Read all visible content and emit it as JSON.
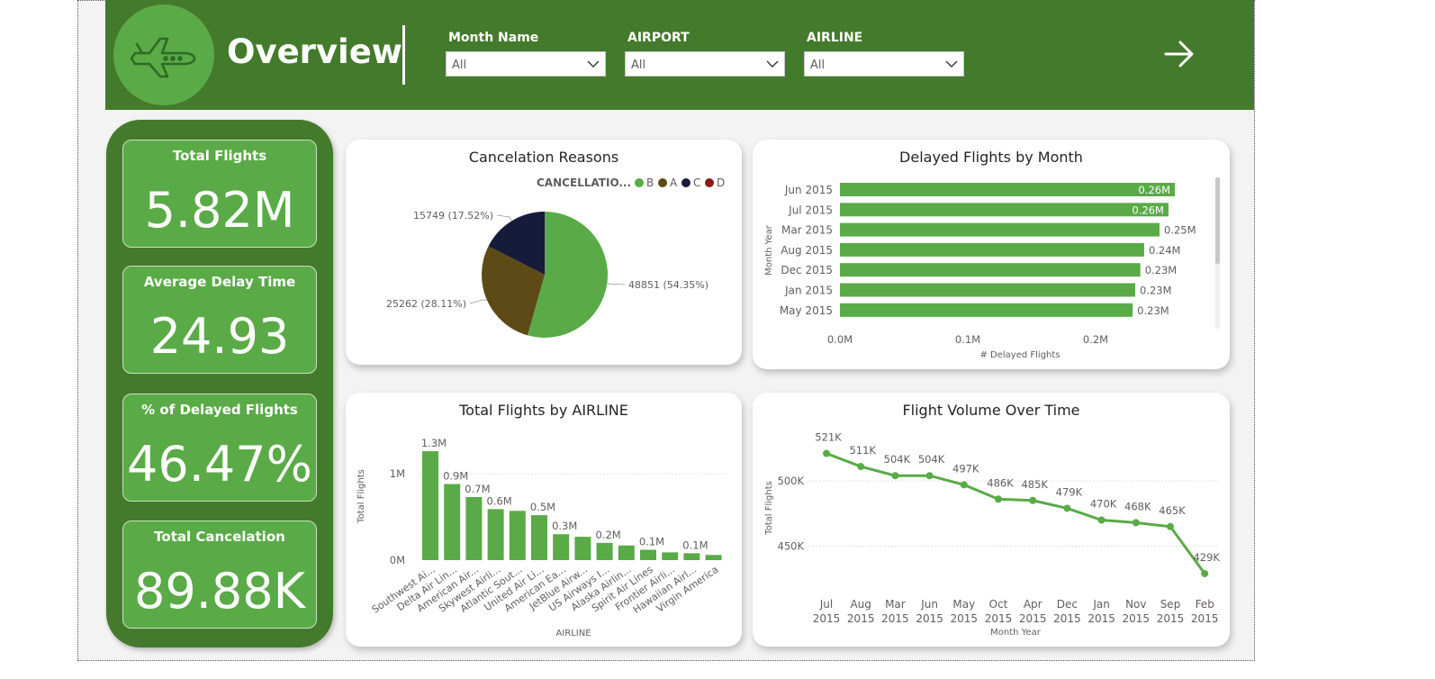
{
  "header": {
    "title": "Overview",
    "slicers": [
      {
        "label": "Month Name",
        "value": "All"
      },
      {
        "label": "AIRPORT",
        "value": "All"
      },
      {
        "label": "AIRLINE",
        "value": "All"
      }
    ],
    "icons": {
      "logo": "airplane-icon",
      "next": "arrow-right-icon",
      "dropdown": "chevron-down-icon"
    }
  },
  "kpis": [
    {
      "title": "Total Flights",
      "value": "5.82M"
    },
    {
      "title": "Average Delay Time",
      "value": "24.93"
    },
    {
      "title": "% of Delayed Flights",
      "value": "46.47%"
    },
    {
      "title": "Total Cancelation",
      "value": "89.88K"
    }
  ],
  "colors": {
    "header": "#447a2c",
    "accent": "#5aaa47",
    "pieB": "#5aaa47",
    "pieA": "#5e4a16",
    "pieC": "#161b3a",
    "pieD": "#8b1a1a"
  },
  "chart_data": [
    {
      "type": "pie",
      "title": "Cancelation Reasons",
      "legend_title": "CANCELLATIO...",
      "legend_position": "top-right",
      "categories": [
        "B",
        "A",
        "C",
        "D"
      ],
      "values": [
        48851,
        25262,
        15749,
        0
      ],
      "labels": [
        "48851 (54.35%)",
        "25262 (28.11%)",
        "15749 (17.52%)",
        ""
      ]
    },
    {
      "type": "bar",
      "orientation": "horizontal",
      "title": "Delayed Flights by Month",
      "xlabel": "# Delayed Flights",
      "ylabel": "Month Year",
      "categories": [
        "Jun 2015",
        "Jul 2015",
        "Mar 2015",
        "Aug 2015",
        "Dec 2015",
        "Jan 2015",
        "May 2015"
      ],
      "values": [
        0.262,
        0.257,
        0.25,
        0.238,
        0.235,
        0.231,
        0.229
      ],
      "data_labels": [
        "0.26M",
        "0.26M",
        "0.25M",
        "0.24M",
        "0.23M",
        "0.23M",
        "0.23M"
      ],
      "xlim": [
        0,
        0.3
      ],
      "xticks": [
        "0.0M",
        "0.1M",
        "0.2M"
      ]
    },
    {
      "type": "bar",
      "title": "Total Flights by AIRLINE",
      "xlabel": "AIRLINE",
      "ylabel": "Total Flights",
      "categories": [
        "Southwest Ai...",
        "Delta Air Lin...",
        "American Air...",
        "Skywest Airli...",
        "Atlantic Sout...",
        "United Air Li...",
        "American Ea...",
        "JetBlue Airw...",
        "US Airways I...",
        "Alaska Airlin...",
        "Spirit Air Lines",
        "Frontier Airli...",
        "Hawaiian Airl...",
        "Virgin America"
      ],
      "values": [
        1.26,
        0.88,
        0.73,
        0.59,
        0.57,
        0.52,
        0.3,
        0.27,
        0.2,
        0.17,
        0.12,
        0.09,
        0.08,
        0.06
      ],
      "data_labels": [
        "1.3M",
        "0.9M",
        "0.7M",
        "0.6M",
        "",
        "0.5M",
        "0.3M",
        "",
        "0.2M",
        "",
        "0.1M",
        "",
        "0.1M",
        ""
      ],
      "ylim": [
        0,
        1.3
      ],
      "yticks": [
        "0M",
        "1M"
      ]
    },
    {
      "type": "line",
      "title": "Flight Volume Over Time",
      "xlabel": "Month Year",
      "ylabel": "Total Flights",
      "x": [
        "Jul 2015",
        "Aug 2015",
        "Mar 2015",
        "Jun 2015",
        "May 2015",
        "Oct 2015",
        "Apr 2015",
        "Dec 2015",
        "Jan 2015",
        "Nov 2015",
        "Sep 2015",
        "Feb 2015"
      ],
      "values": [
        521,
        511,
        504,
        504,
        497,
        486,
        485,
        479,
        470,
        468,
        465,
        429
      ],
      "data_labels": [
        "521K",
        "511K",
        "504K",
        "504K",
        "497K",
        "486K",
        "485K",
        "479K",
        "470K",
        "468K",
        "465K",
        "429K"
      ],
      "yticks": [
        "500K",
        "450K"
      ]
    }
  ]
}
